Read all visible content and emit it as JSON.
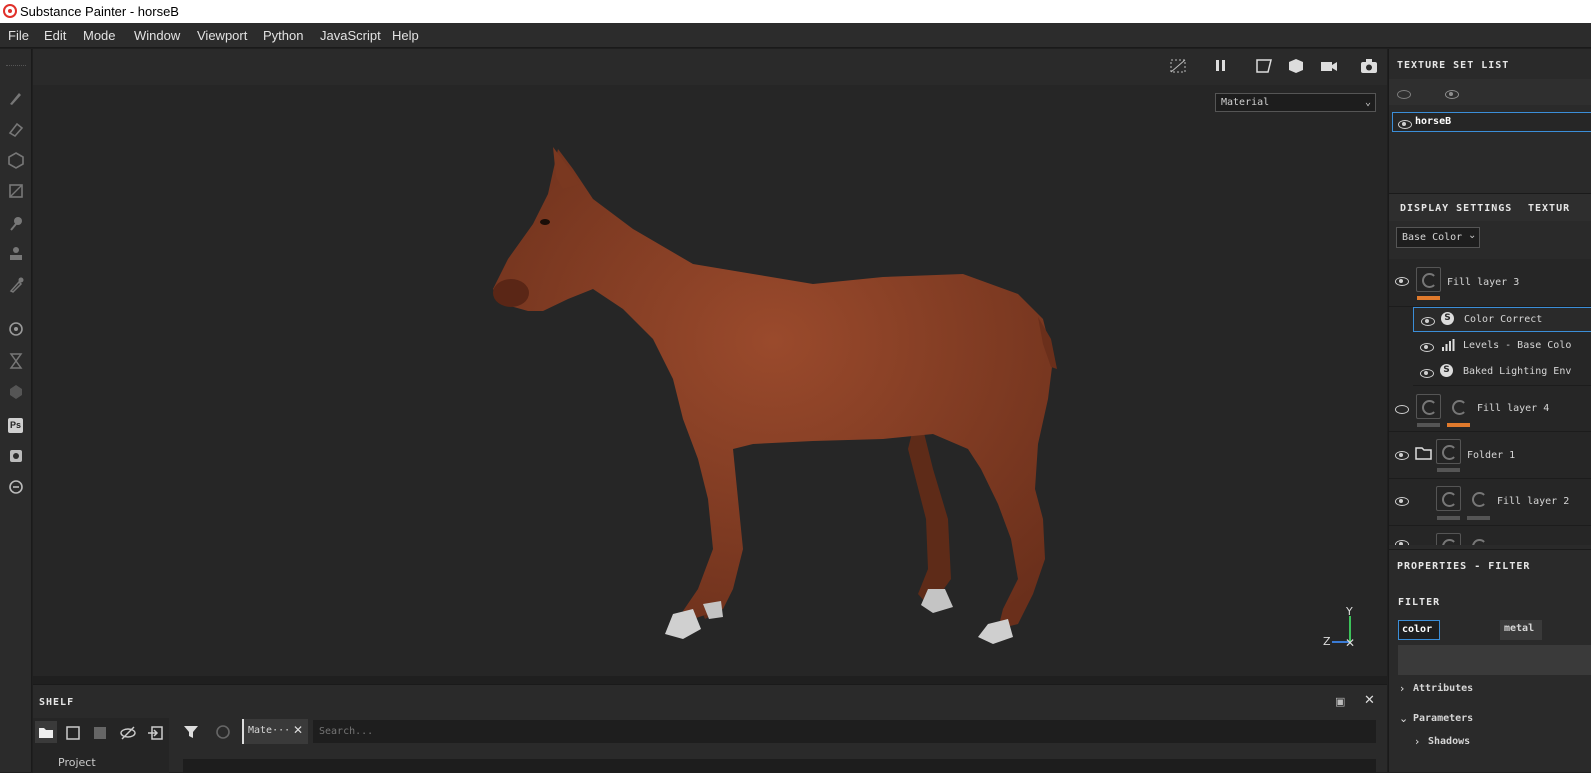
{
  "window": {
    "title": "Substance Painter - horseB"
  },
  "menu": [
    "File",
    "Edit",
    "Mode",
    "Window",
    "Viewport",
    "Python",
    "JavaScript",
    "Help"
  ],
  "viewport": {
    "material_select": "Material",
    "axis": {
      "y": "Y",
      "z": "Z"
    }
  },
  "texture_set_list": {
    "title": "TEXTURE SET LIST",
    "item": "horseB"
  },
  "layers": {
    "tab_display": "DISPLAY SETTINGS",
    "tab_texture": "TEXTUR",
    "channel_select": "Base Color",
    "items": [
      {
        "label": "Fill layer 3"
      },
      {
        "label": "Color Correct"
      },
      {
        "label": "Levels - Base Colo"
      },
      {
        "label": "Baked Lighting Env"
      },
      {
        "label": "Fill layer 4"
      },
      {
        "label": "Folder 1"
      },
      {
        "label": "Fill layer 2"
      }
    ]
  },
  "properties": {
    "title": "PROPERTIES - FILTER",
    "filter_label": "FILTER",
    "chip_color": "color",
    "chip_metal": "metal",
    "attributes": "Attributes",
    "parameters": "Parameters",
    "shadows": "Shadows"
  },
  "shelf": {
    "title": "SHELF",
    "tab": "Mate···",
    "search_placeholder": "Search...",
    "project_label": "Project"
  },
  "colors": {
    "accent_orange": "#e07a2c",
    "selection_blue": "#3b8ed8",
    "horse": "#7a3a22"
  }
}
